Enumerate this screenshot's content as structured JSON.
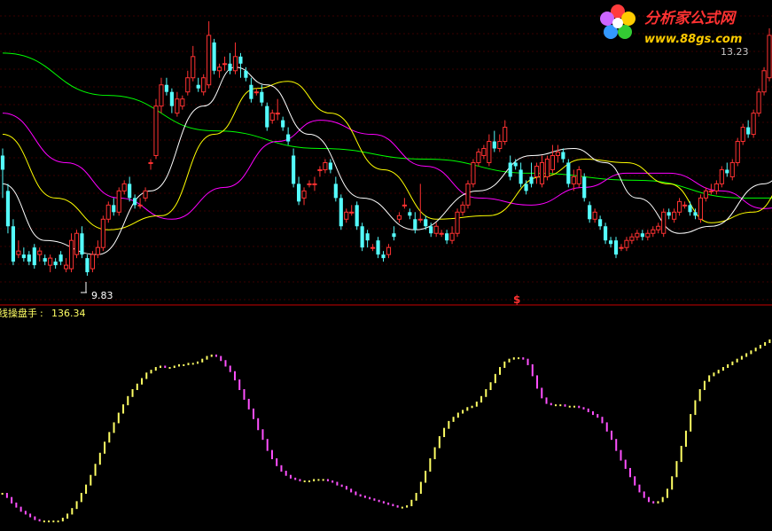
{
  "watermark": {
    "title": "分析家公式网",
    "url": "www.88gs.com"
  },
  "chart_data": [
    {
      "type": "candlestick",
      "panel": "price",
      "ylim": [
        9.3,
        13.6
      ],
      "annotations": {
        "low_label": "9.83",
        "high_label": "13.23",
        "signal_marker": "$"
      },
      "colors": {
        "up": "#ff3232",
        "down": "#54fcfc",
        "ma_fast": "#ffffff",
        "ma_mid": "#ffff00",
        "ma_slow": "#ff00ff",
        "ma_long": "#00ff00",
        "divider": "#c80000"
      },
      "candles": [
        [
          11.4,
          11.2,
          11.5,
          10.8
        ],
        [
          10.9,
          10.4,
          11.0,
          10.3
        ],
        [
          10.4,
          9.9,
          10.5,
          9.85
        ],
        [
          10.0,
          10.05,
          10.2,
          9.95
        ],
        [
          10.0,
          9.95,
          10.1,
          9.9
        ],
        [
          10.0,
          9.9,
          10.05,
          9.85
        ],
        [
          10.1,
          9.85,
          10.15,
          9.8
        ],
        [
          10.0,
          10.05,
          10.1,
          9.9
        ],
        [
          9.95,
          9.9,
          10.0,
          9.85
        ],
        [
          9.85,
          9.95,
          10.0,
          9.75
        ],
        [
          9.9,
          9.85,
          9.95,
          9.8
        ],
        [
          10.0,
          9.9,
          10.05,
          9.85
        ],
        [
          9.8,
          9.85,
          9.95,
          9.75
        ],
        [
          9.8,
          10.2,
          10.3,
          9.75
        ],
        [
          10.0,
          10.3,
          10.35,
          9.95
        ],
        [
          10.3,
          10.0,
          10.4,
          9.95
        ],
        [
          9.95,
          9.75,
          10.0,
          9.7
        ],
        [
          9.8,
          10.0,
          10.05,
          9.75
        ],
        [
          10.0,
          10.1,
          10.2,
          9.95
        ],
        [
          10.1,
          10.5,
          10.55,
          10.05
        ],
        [
          10.5,
          10.7,
          10.75,
          10.45
        ],
        [
          10.7,
          10.6,
          10.8,
          10.55
        ],
        [
          10.6,
          10.9,
          10.95,
          10.55
        ],
        [
          10.9,
          11.0,
          11.05,
          10.85
        ],
        [
          11.0,
          10.8,
          11.1,
          10.75
        ],
        [
          10.8,
          10.7,
          10.85,
          10.65
        ],
        [
          10.7,
          10.7,
          10.8,
          10.65
        ],
        [
          10.8,
          10.9,
          10.95,
          10.75
        ],
        [
          11.3,
          11.3,
          11.35,
          11.2
        ],
        [
          11.4,
          12.1,
          12.2,
          11.35
        ],
        [
          12.1,
          12.4,
          12.5,
          12.0
        ],
        [
          12.4,
          12.3,
          12.5,
          12.25
        ],
        [
          12.3,
          12.1,
          12.35,
          12.0
        ],
        [
          12.0,
          12.2,
          12.3,
          11.95
        ],
        [
          12.1,
          12.2,
          12.25,
          12.05
        ],
        [
          12.3,
          12.5,
          12.6,
          12.25
        ],
        [
          12.5,
          12.8,
          12.95,
          12.45
        ],
        [
          12.4,
          12.35,
          12.5,
          12.3
        ],
        [
          12.3,
          12.5,
          12.55,
          12.25
        ],
        [
          12.4,
          13.1,
          13.3,
          12.35
        ],
        [
          13.0,
          12.6,
          13.05,
          12.55
        ],
        [
          12.6,
          12.65,
          12.7,
          12.5
        ],
        [
          12.7,
          12.7,
          12.8,
          12.6
        ],
        [
          12.7,
          12.6,
          12.85,
          12.55
        ],
        [
          12.6,
          12.8,
          13.0,
          12.55
        ],
        [
          12.8,
          12.7,
          12.85,
          12.5
        ],
        [
          12.6,
          12.5,
          12.65,
          12.45
        ],
        [
          12.4,
          12.2,
          12.5,
          12.15
        ],
        [
          12.3,
          12.3,
          12.35,
          12.25
        ],
        [
          12.3,
          12.15,
          12.4,
          12.1
        ],
        [
          12.1,
          11.8,
          12.15,
          11.75
        ],
        [
          11.9,
          12.0,
          12.05,
          11.85
        ],
        [
          12.0,
          12.0,
          12.2,
          11.9
        ],
        [
          11.9,
          11.8,
          11.95,
          11.75
        ],
        [
          11.7,
          11.6,
          11.8,
          11.55
        ],
        [
          11.4,
          11.0,
          11.5,
          10.95
        ],
        [
          11.0,
          10.75,
          11.1,
          10.7
        ],
        [
          10.8,
          10.9,
          10.95,
          10.7
        ],
        [
          11.0,
          11.0,
          11.05,
          10.95
        ],
        [
          11.0,
          11.0,
          11.1,
          10.9
        ],
        [
          11.2,
          11.2,
          11.25,
          11.1
        ],
        [
          11.2,
          11.3,
          11.35,
          11.15
        ],
        [
          11.3,
          11.2,
          11.35,
          11.15
        ],
        [
          11.0,
          10.8,
          11.1,
          10.75
        ],
        [
          10.8,
          10.4,
          10.85,
          10.35
        ],
        [
          10.5,
          10.6,
          10.65,
          10.45
        ],
        [
          10.6,
          10.6,
          10.7,
          10.55
        ],
        [
          10.7,
          10.4,
          10.75,
          10.35
        ],
        [
          10.4,
          10.1,
          10.45,
          10.05
        ],
        [
          10.3,
          10.2,
          10.35,
          10.1
        ],
        [
          10.1,
          10.1,
          10.15,
          10.05
        ],
        [
          10.2,
          10.0,
          10.25,
          9.95
        ],
        [
          10.0,
          9.95,
          10.05,
          9.9
        ],
        [
          10.0,
          10.1,
          10.15,
          9.95
        ],
        [
          10.3,
          10.25,
          10.4,
          10.2
        ],
        [
          10.5,
          10.55,
          10.6,
          10.45
        ],
        [
          10.7,
          10.7,
          10.8,
          10.65
        ],
        [
          10.6,
          10.55,
          10.65,
          10.5
        ],
        [
          10.5,
          10.35,
          10.6,
          10.3
        ],
        [
          10.5,
          10.5,
          11.0,
          10.45
        ],
        [
          10.5,
          10.4,
          10.55,
          10.35
        ],
        [
          10.4,
          10.3,
          10.45,
          10.25
        ],
        [
          10.3,
          10.4,
          10.45,
          10.25
        ],
        [
          10.3,
          10.3,
          10.35,
          10.25
        ],
        [
          10.3,
          10.2,
          10.35,
          10.15
        ],
        [
          10.2,
          10.3,
          10.4,
          10.15
        ],
        [
          10.3,
          10.6,
          10.65,
          10.25
        ],
        [
          10.6,
          10.7,
          10.75,
          10.55
        ],
        [
          10.7,
          11.0,
          11.05,
          10.65
        ],
        [
          11.0,
          11.3,
          11.35,
          10.95
        ],
        [
          11.3,
          11.45,
          11.5,
          11.25
        ],
        [
          11.4,
          11.5,
          11.55,
          11.35
        ],
        [
          11.3,
          11.6,
          11.7,
          11.25
        ],
        [
          11.6,
          11.5,
          11.75,
          11.45
        ],
        [
          11.5,
          11.6,
          11.7,
          11.45
        ],
        [
          11.6,
          11.8,
          11.9,
          11.55
        ],
        [
          11.3,
          11.1,
          11.4,
          11.05
        ],
        [
          11.3,
          11.25,
          11.35,
          11.2
        ],
        [
          11.2,
          11.0,
          11.3,
          10.95
        ],
        [
          11.0,
          10.9,
          11.05,
          10.85
        ],
        [
          11.1,
          11.0,
          11.3,
          10.95
        ],
        [
          11.1,
          11.25,
          11.3,
          11.0
        ],
        [
          11.0,
          11.3,
          11.4,
          10.95
        ],
        [
          11.1,
          11.35,
          11.4,
          11.05
        ],
        [
          11.2,
          11.4,
          11.55,
          11.15
        ],
        [
          11.4,
          11.45,
          11.55,
          11.3
        ],
        [
          11.45,
          11.35,
          11.5,
          11.3
        ],
        [
          11.3,
          11.0,
          11.35,
          10.95
        ],
        [
          11.0,
          11.1,
          11.2,
          10.9
        ],
        [
          11.0,
          11.2,
          11.25,
          10.95
        ],
        [
          11.1,
          10.8,
          11.15,
          10.75
        ],
        [
          10.7,
          10.5,
          10.75,
          10.45
        ],
        [
          10.5,
          10.6,
          10.65,
          10.45
        ],
        [
          10.5,
          10.4,
          10.55,
          10.35
        ],
        [
          10.4,
          10.2,
          10.45,
          10.15
        ],
        [
          10.2,
          10.15,
          10.25,
          10.1
        ],
        [
          10.2,
          10.0,
          10.25,
          9.95
        ],
        [
          10.1,
          10.1,
          10.15,
          10.05
        ],
        [
          10.1,
          10.2,
          10.25,
          10.05
        ],
        [
          10.2,
          10.25,
          10.3,
          10.15
        ],
        [
          10.25,
          10.3,
          10.35,
          10.2
        ],
        [
          10.3,
          10.25,
          10.35,
          10.2
        ],
        [
          10.25,
          10.3,
          10.35,
          10.2
        ],
        [
          10.3,
          10.35,
          10.4,
          10.25
        ],
        [
          10.35,
          10.4,
          10.45,
          10.3
        ],
        [
          10.3,
          10.6,
          10.65,
          10.25
        ],
        [
          10.6,
          10.55,
          10.65,
          10.5
        ],
        [
          10.5,
          10.6,
          10.65,
          10.45
        ],
        [
          10.6,
          10.75,
          10.8,
          10.55
        ],
        [
          10.7,
          10.7,
          10.75,
          10.65
        ],
        [
          10.7,
          10.6,
          10.75,
          10.55
        ],
        [
          10.6,
          10.55,
          10.65,
          10.5
        ],
        [
          10.5,
          10.8,
          10.85,
          10.45
        ],
        [
          10.8,
          10.9,
          10.95,
          10.75
        ],
        [
          10.9,
          10.9,
          11.0,
          10.85
        ],
        [
          10.9,
          11.0,
          11.05,
          10.85
        ],
        [
          11.0,
          11.2,
          11.25,
          10.95
        ],
        [
          11.2,
          11.15,
          11.3,
          11.1
        ],
        [
          11.1,
          11.3,
          11.35,
          11.05
        ],
        [
          11.3,
          11.6,
          11.65,
          11.25
        ],
        [
          11.6,
          11.8,
          11.85,
          11.55
        ],
        [
          11.8,
          11.7,
          11.9,
          11.65
        ],
        [
          11.7,
          12.0,
          12.05,
          11.65
        ],
        [
          12.0,
          12.3,
          12.35,
          11.95
        ],
        [
          12.3,
          12.6,
          12.65,
          12.25
        ],
        [
          12.5,
          13.1,
          13.2,
          12.45
        ]
      ],
      "lines": {
        "ma_fast": [
          [
            0,
            11.0
          ],
          [
            8,
            10.2
          ],
          [
            18,
            10.0
          ],
          [
            28,
            10.9
          ],
          [
            38,
            12.1
          ],
          [
            44,
            12.65
          ],
          [
            50,
            12.4
          ],
          [
            58,
            11.7
          ],
          [
            68,
            10.8
          ],
          [
            78,
            10.35
          ],
          [
            90,
            10.9
          ],
          [
            100,
            11.4
          ],
          [
            108,
            11.5
          ],
          [
            114,
            11.3
          ],
          [
            120,
            10.8
          ],
          [
            128,
            10.3
          ],
          [
            134,
            10.4
          ],
          [
            144,
            11.0
          ],
          [
            154,
            12.2
          ],
          [
            156,
            12.5
          ]
        ],
        "ma_mid": [
          [
            0,
            11.7
          ],
          [
            10,
            10.8
          ],
          [
            20,
            10.35
          ],
          [
            30,
            10.55
          ],
          [
            40,
            11.7
          ],
          [
            48,
            12.35
          ],
          [
            54,
            12.45
          ],
          [
            62,
            12.0
          ],
          [
            72,
            11.2
          ],
          [
            82,
            10.5
          ],
          [
            92,
            10.55
          ],
          [
            102,
            11.1
          ],
          [
            110,
            11.35
          ],
          [
            118,
            11.3
          ],
          [
            126,
            11.0
          ],
          [
            134,
            10.45
          ],
          [
            142,
            10.6
          ],
          [
            150,
            11.2
          ],
          [
            156,
            11.7
          ]
        ],
        "ma_slow": [
          [
            0,
            12.0
          ],
          [
            12,
            11.3
          ],
          [
            22,
            10.8
          ],
          [
            32,
            10.5
          ],
          [
            42,
            10.95
          ],
          [
            52,
            11.6
          ],
          [
            60,
            11.9
          ],
          [
            70,
            11.7
          ],
          [
            80,
            11.25
          ],
          [
            90,
            10.8
          ],
          [
            100,
            10.7
          ],
          [
            110,
            10.95
          ],
          [
            118,
            11.15
          ],
          [
            126,
            11.15
          ],
          [
            136,
            10.9
          ],
          [
            144,
            10.65
          ],
          [
            152,
            10.8
          ],
          [
            156,
            11.0
          ]
        ],
        "ma_long": [
          [
            0,
            12.85
          ],
          [
            20,
            12.25
          ],
          [
            40,
            11.75
          ],
          [
            60,
            11.5
          ],
          [
            80,
            11.35
          ],
          [
            100,
            11.15
          ],
          [
            120,
            11.05
          ],
          [
            140,
            10.8
          ],
          [
            156,
            10.8
          ]
        ]
      }
    },
    {
      "type": "bar",
      "panel": "indicator",
      "label": "线操盘手",
      "current_value": "136.34",
      "ylim": [
        0,
        150
      ],
      "colors": {
        "up": "#ffff64",
        "down": "#ff50ff"
      },
      "values": [
        25,
        22,
        18,
        15,
        12,
        10,
        8,
        6,
        5,
        5,
        5,
        5,
        5,
        7,
        10,
        14,
        19,
        25,
        31,
        38,
        46,
        54,
        62,
        69,
        76,
        83,
        89,
        95,
        100,
        104,
        108,
        112,
        114,
        116,
        117,
        116,
        116,
        117,
        118,
        118,
        119,
        119,
        120,
        122,
        124,
        125,
        124,
        121,
        117,
        113,
        107,
        100,
        93,
        86,
        79,
        71,
        64,
        56,
        50,
        45,
        41,
        38,
        36,
        35,
        34,
        34,
        34,
        35,
        35,
        35,
        34,
        33,
        31,
        30,
        28,
        26,
        24,
        23,
        22,
        21,
        20,
        19,
        18,
        17,
        16,
        15,
        15,
        16,
        20,
        25,
        33,
        41,
        50,
        58,
        66,
        72,
        77,
        80,
        83,
        85,
        87,
        88,
        91,
        95,
        100,
        105,
        111,
        116,
        120,
        122,
        123,
        123,
        122,
        118,
        110,
        101,
        94,
        90,
        89,
        89,
        89,
        88,
        88,
        88,
        87,
        86,
        84,
        82,
        80,
        76,
        70,
        64,
        56,
        49,
        43,
        37,
        31,
        26,
        22,
        19,
        18,
        19,
        22,
        28,
        37,
        48,
        59,
        70,
        82,
        92,
        100,
        106,
        110,
        112,
        114,
        116,
        118,
        120,
        122,
        124,
        126,
        128,
        130,
        132,
        134,
        136
      ]
    }
  ]
}
